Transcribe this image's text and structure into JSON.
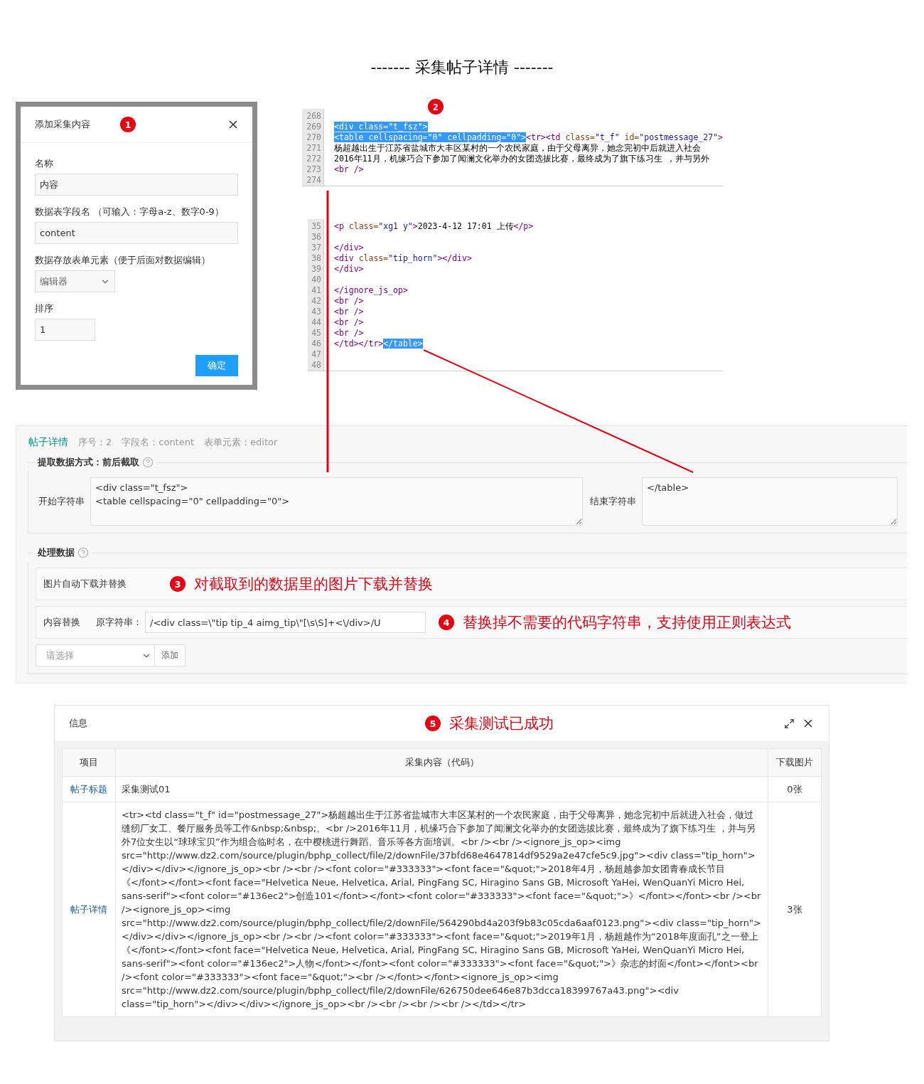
{
  "page_title": "------- 采集帖子详情 -------",
  "add_dialog": {
    "title": "添加采集内容",
    "badge": "1",
    "fields": [
      {
        "kind": "text",
        "label": "名称",
        "value": "内容"
      },
      {
        "kind": "text",
        "label": "数据表字段名 （可输入：字母a-z、数字0-9）",
        "value": "content"
      },
      {
        "kind": "select",
        "label": "数据存放表单元素（便于后面对数据编辑）",
        "value": "编辑器"
      },
      {
        "kind": "short",
        "label": "排序",
        "value": "1"
      }
    ],
    "confirm": "确定"
  },
  "code_view": {
    "badge": "2",
    "panels": [
      {
        "lines": [
          {
            "number": "268"
          },
          {
            "number": "269",
            "segments": [
              {
                "text": "<div class=\"t_fsz\">",
                "kind": "tag",
                "highlighted": true
              }
            ]
          },
          {
            "number": "270",
            "segments": [
              {
                "text": "<table cellspacing=\"0\" cellpadding=\"0\">",
                "kind": "tag",
                "highlighted": true
              },
              {
                "text": "<tr><td ",
                "kind": "tag",
                "highlighted": false
              },
              {
                "text": "class=",
                "kind": "attr",
                "highlighted": false
              },
              {
                "text": "\"t_f\"",
                "kind": "value",
                "highlighted": false
              },
              {
                "text": " id=",
                "kind": "attr",
                "highlighted": false
              },
              {
                "text": "\"postmessage_27\"",
                "kind": "value",
                "highlighted": false
              },
              {
                "text": ">",
                "kind": "tag",
                "highlighted": false
              }
            ]
          },
          {
            "number": "271",
            "segments": [
              {
                "text": "杨超越出生于江苏省盐城市大丰区某村的一个农民家庭，由于父母离异，她念完初中后就进入社会",
                "kind": "text",
                "highlighted": false
              }
            ]
          },
          {
            "number": "272",
            "segments": [
              {
                "text": "2016年11月，机缘巧合下参加了闻澜文化举办的女团选拔比赛，最终成为了旗下练习生 ，并与另外",
                "kind": "text",
                "highlighted": false
              }
            ]
          },
          {
            "number": "273",
            "segments": [
              {
                "text": "<br />",
                "kind": "tag",
                "highlighted": false
              }
            ]
          },
          {
            "number": "274"
          }
        ]
      },
      {
        "lines": [
          {
            "number": "35",
            "segments": [
              {
                "text": "<p ",
                "kind": "tag",
                "highlighted": false
              },
              {
                "text": "class=",
                "kind": "attr",
                "highlighted": false
              },
              {
                "text": "\"xg1 y\"",
                "kind": "value",
                "highlighted": false
              },
              {
                "text": ">",
                "kind": "tag",
                "highlighted": false
              },
              {
                "text": "2023-4-12 17:01 上传",
                "kind": "text",
                "highlighted": false
              },
              {
                "text": "</p>",
                "kind": "tag",
                "highlighted": false
              }
            ]
          },
          {
            "number": "36"
          },
          {
            "number": "37",
            "segments": [
              {
                "text": "</div>",
                "kind": "tag",
                "highlighted": false
              }
            ]
          },
          {
            "number": "38",
            "segments": [
              {
                "text": "<div ",
                "kind": "tag",
                "highlighted": false
              },
              {
                "text": "class=",
                "kind": "attr",
                "highlighted": false
              },
              {
                "text": "\"tip_horn\"",
                "kind": "value",
                "highlighted": false
              },
              {
                "text": "></div>",
                "kind": "tag",
                "highlighted": false
              }
            ]
          },
          {
            "number": "39",
            "segments": [
              {
                "text": "</div>",
                "kind": "tag",
                "highlighted": false
              }
            ]
          },
          {
            "number": "40"
          },
          {
            "number": "41",
            "segments": [
              {
                "text": "</ignore_js_op>",
                "kind": "tag",
                "highlighted": false
              }
            ]
          },
          {
            "number": "42",
            "segments": [
              {
                "text": "<br />",
                "kind": "tag",
                "highlighted": false
              }
            ]
          },
          {
            "number": "43",
            "segments": [
              {
                "text": "<br />",
                "kind": "tag",
                "highlighted": false
              }
            ]
          },
          {
            "number": "44",
            "segments": [
              {
                "text": "<br />",
                "kind": "tag",
                "highlighted": false
              }
            ]
          },
          {
            "number": "45",
            "segments": [
              {
                "text": "<br />",
                "kind": "tag",
                "highlighted": false
              }
            ]
          },
          {
            "number": "46",
            "segments": [
              {
                "text": "</td></tr>",
                "kind": "tag",
                "highlighted": false
              },
              {
                "text": "</table>",
                "kind": "tag",
                "highlighted": true
              }
            ]
          },
          {
            "number": "47"
          },
          {
            "number": "48"
          }
        ]
      }
    ]
  },
  "detail_panel": {
    "title": "帖子详情",
    "meta": [
      "序号：2",
      "字段名：content",
      "表单元素：editor"
    ],
    "extract": {
      "legend": "提取数据方式：前后截取",
      "start_label": "开始字符串",
      "start_value": "<div class=\"t_fsz\">\n<table cellspacing=\"0\" cellpadding=\"0\">",
      "end_label": "结束字符串",
      "end_value": "</table>"
    },
    "process": {
      "legend": "处理数据",
      "image_option": "图片自动下载并替换",
      "image_note": {
        "badge": "3",
        "text": "对截取到的数据里的图片下载并替换"
      },
      "replace": {
        "label": "内容替换",
        "source_label": "原字符串：",
        "source_value": "/<div class=\\\"tip tip_4 aimg_tip\\\"[\\s\\S]+<\\/div>/U",
        "note": {
          "badge": "4",
          "text": "替换掉不需要的代码字符串，支持使用正则表达式"
        }
      },
      "select_placeholder": "请选择",
      "add_button": "添加"
    }
  },
  "result_dialog": {
    "title": "信息",
    "note": {
      "badge": "5",
      "text": "采集测试已成功"
    },
    "columns": [
      "项目",
      "采集内容（代码）",
      "下载图片"
    ],
    "rows": [
      {
        "item": "帖子标题",
        "content": "采集测试01",
        "images": "0张"
      },
      {
        "item": "帖子详情",
        "content": "<tr><td class=\"t_f\" id=\"postmessage_27\">杨超越出生于江苏省盐城市大丰区某村的一个农民家庭，由于父母离异，她念完初中后就进入社会，做过缝纫厂女工、餐厅服务员等工作&nbsp;&nbsp;。<br />2016年11月，机缘巧合下参加了闻澜文化举办的女团选拔比赛，最终成为了旗下练习生 ，并与另外7位女生以“球球宝贝”作为组合临时名，在中樱桃进行舞蹈、音乐等各方面培训。<br /><br /><ignore_js_op><img src=\"http://www.dz2.com/source/plugin/bphp_collect/file/2/downFile/37bfd68e4647814df9529a2e47cfe5c9.jpg\"><div class=\"tip_horn\"></div></div></ignore_js_op><br /><br /><font color=\"#333333\"><font face=\"&quot;\">2018年4月，杨超越参加女团青春成长节目《</font></font><font face=\"Helvetica Neue, Helvetica, Arial, PingFang SC, Hiragino Sans GB, Microsoft YaHei, WenQuanYi Micro Hei, sans-serif\"><font color=\"#136ec2\">创造101</font></font><font color=\"#333333\"><font face=\"&quot;\">》</font></font><br /><br /><ignore_js_op><img src=\"http://www.dz2.com/source/plugin/bphp_collect/file/2/downFile/564290bd4a203f9b83c05cda6aaf0123.png\"><div class=\"tip_horn\"></div></div></ignore_js_op><br /><br /><font color=\"#333333\"><font face=\"&quot;\">2019年1月，杨超越作为“2018年度面孔”之一登上《</font></font><font face=\"Helvetica Neue, Helvetica, Arial, PingFang SC, Hiragino Sans GB, Microsoft YaHei, WenQuanYi Micro Hei, sans-serif\"><font color=\"#136ec2\">人物</font></font><font color=\"#333333\"><font face=\"&quot;\">》杂志的封面</font></font><br /><font color=\"#333333\"><font face=\"&quot;\"><br /></font></font><ignore_js_op><img src=\"http://www.dz2.com/source/plugin/bphp_collect/file/2/downFile/626750dee646e87b3dcca18399767a43.png\"><div class=\"tip_horn\"></div></div></ignore_js_op><br /><br /><br /><br /></td></tr>",
        "images": "3张"
      }
    ]
  }
}
